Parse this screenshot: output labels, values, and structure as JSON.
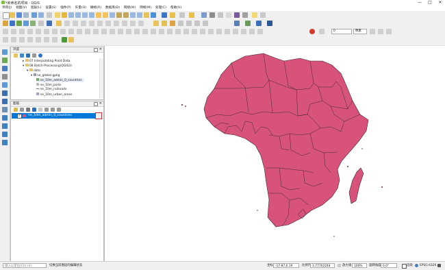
{
  "window": {
    "title": "*未命名的项目 - QGIS",
    "minimize": "—",
    "maximize": "□",
    "close": "✕"
  },
  "menus": [
    "项目(J)",
    "视图(V)",
    "图层(L)",
    "设置(S)",
    "插件(P)",
    "矢量(O)",
    "栅格(R)",
    "数据库(D)",
    "网络(W)",
    "网格(M)",
    "处理(C)",
    "帮助(H)"
  ],
  "browser_panel": {
    "title": "浏览",
    "items": [
      {
        "label": "07 Interpolating Point Data",
        "indent": 1,
        "icon": "folder"
      },
      {
        "label": "08 Batch-Processing(QGIS3)",
        "indent": 1,
        "icon": "folder"
      },
      {
        "label": "data",
        "indent": 2,
        "icon": "folder"
      },
      {
        "label": "ne_global.gpkg",
        "indent": 3,
        "icon": "database"
      },
      {
        "label": "ne_10m_admin_0_countries",
        "indent": 4,
        "icon": "polygon"
      },
      {
        "label": "ne_10m_ports",
        "indent": 4,
        "icon": "point"
      },
      {
        "label": "ne_10m_railroads",
        "indent": 4,
        "icon": "line"
      },
      {
        "label": "ne_10m_urban_areas",
        "indent": 4,
        "icon": "polygon"
      }
    ]
  },
  "layers_panel": {
    "title": "图层",
    "layer_name": "ne_10m_admin_0_countries",
    "layer_checked": true
  },
  "map": {
    "fill_color": "#d8537a",
    "stroke_color": "#3a2a30"
  },
  "status": {
    "search_placeholder": "键入以定位(Ctrl+K)",
    "message": "切换当前图层的编辑状态",
    "coord_label": "坐标",
    "coord_value": "-17.87,6.19",
    "scale_label": "比例尺",
    "scale_value": "1:77702244",
    "magnifier_label": "放大镜",
    "magnifier_value": "100%",
    "rotation_label": "旋转角度",
    "rotation_value": "0.0°",
    "render_label": "渲染",
    "crs": "EPSG:4326"
  },
  "toolbar": {
    "scale_combo": "0",
    "unit_combo": "像素"
  }
}
